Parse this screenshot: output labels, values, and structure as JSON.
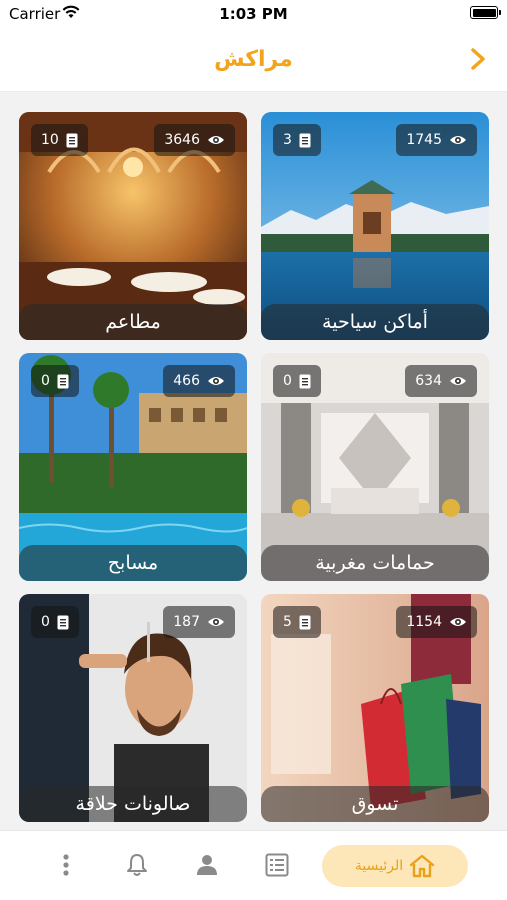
{
  "status_bar": {
    "carrier": "Carrier",
    "time": "1:03 PM"
  },
  "header": {
    "title": "مراكش",
    "accent_color": "#f2a51a"
  },
  "categories": [
    {
      "label": "أماكن سياحية",
      "views": "1745",
      "docs": "3",
      "theme": "tourist-places"
    },
    {
      "label": "مطاعم",
      "views": "3646",
      "docs": "10",
      "theme": "restaurants"
    },
    {
      "label": "حمامات مغربية",
      "views": "634",
      "docs": "0",
      "theme": "moroccan-baths"
    },
    {
      "label": "مسابح",
      "views": "466",
      "docs": "0",
      "theme": "pools"
    },
    {
      "label": "تسوق",
      "views": "1154",
      "docs": "5",
      "theme": "shopping"
    },
    {
      "label": "صالونات حلاقة",
      "views": "187",
      "docs": "0",
      "theme": "barber-salons"
    }
  ],
  "tabbar": {
    "home_label": "الرئيسية",
    "items": [
      "more-icon",
      "bell-icon",
      "user-icon",
      "list-icon",
      "home-icon"
    ]
  }
}
